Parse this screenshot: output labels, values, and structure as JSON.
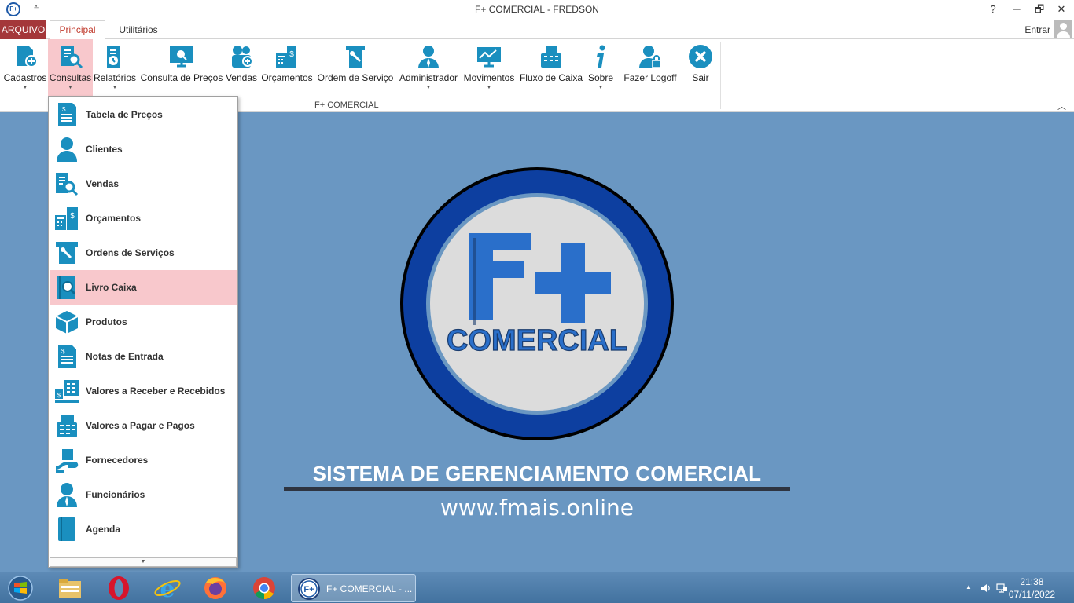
{
  "window": {
    "title": "F+ COMERCIAL - FREDSON",
    "app_icon_text": "F+",
    "quick_access": "⩡",
    "buttons": {
      "help": "?",
      "minimize": "─",
      "restore": "🗗",
      "close": "✕"
    }
  },
  "tabs": {
    "arquivo": "ARQUIVO",
    "principal": "Principal",
    "utilitarios": "Utilitários",
    "entrar": "Entrar"
  },
  "ribbon": {
    "group_label": "F+ COMERCIAL",
    "collapse": "︿",
    "buttons": [
      {
        "label": "Cadastros",
        "icon": "add-document-icon"
      },
      {
        "label": "Consultas",
        "icon": "search-document-icon"
      },
      {
        "label": "Relatórios",
        "icon": "report-clock-icon"
      },
      {
        "label": "Consulta de Preços",
        "icon": "monitor-search-icon"
      },
      {
        "label": "Vendas",
        "icon": "sales-bag-icon"
      },
      {
        "label": "Orçamentos",
        "icon": "budget-calculator-icon"
      },
      {
        "label": "Ordem de Serviço",
        "icon": "service-order-icon"
      },
      {
        "label": "Administrador",
        "icon": "admin-user-icon"
      },
      {
        "label": "Movimentos",
        "icon": "movements-chart-icon"
      },
      {
        "label": "Fluxo de Caixa",
        "icon": "cash-register-icon"
      },
      {
        "label": "Sobre",
        "icon": "info-icon"
      },
      {
        "label": "Fazer Logoff",
        "icon": "logoff-user-icon"
      },
      {
        "label": "Sair",
        "icon": "close-circle-icon"
      }
    ]
  },
  "dropdown": {
    "items": [
      {
        "label": "Tabela de Preços",
        "icon": "price-list-icon"
      },
      {
        "label": "Clientes",
        "icon": "client-icon"
      },
      {
        "label": "Vendas",
        "icon": "sales-search-icon"
      },
      {
        "label": "Orçamentos",
        "icon": "budget-icon"
      },
      {
        "label": "Ordens de Serviços",
        "icon": "service-order-icon"
      },
      {
        "label": "Livro Caixa",
        "icon": "cash-book-icon"
      },
      {
        "label": "Produtos",
        "icon": "product-box-icon"
      },
      {
        "label": "Notas de Entrada",
        "icon": "invoice-icon"
      },
      {
        "label": "Valores a Receber e Recebidos",
        "icon": "receivables-icon"
      },
      {
        "label": "Valores a Pagar e Pagos",
        "icon": "payables-icon"
      },
      {
        "label": "Fornecedores",
        "icon": "supplier-icon"
      },
      {
        "label": "Funcionários",
        "icon": "employee-icon"
      },
      {
        "label": "Agenda",
        "icon": "agenda-icon"
      }
    ],
    "scroll_arrow": "▼"
  },
  "main": {
    "logo_big": "F+",
    "logo_word": "COMERCIAL",
    "subtitle": "SISTEMA DE GERENCIAMENTO COMERCIAL",
    "url": "www.fmais.online"
  },
  "taskbar": {
    "task_label": "F+ COMERCIAL - ...",
    "task_icon_text": "F+",
    "time": "21:38",
    "date": "07/11/2022",
    "tray_up": "▲"
  },
  "colors": {
    "accent_red": "#a4373a",
    "ribbon_icon": "#1a8fbf",
    "highlight": "#f8c8cc",
    "background": "#6a97c2"
  }
}
